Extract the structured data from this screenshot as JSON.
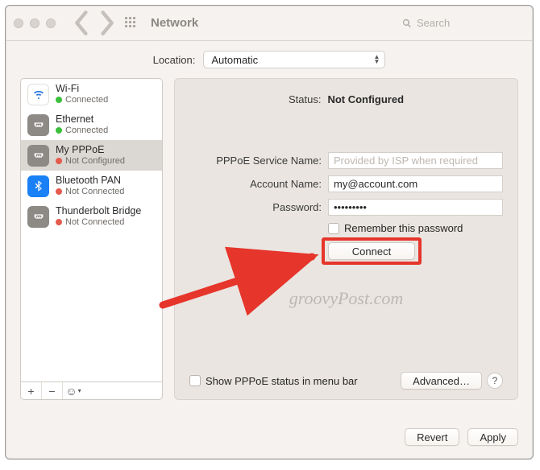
{
  "title": "Network",
  "search_placeholder": "Search",
  "location": {
    "label": "Location:",
    "value": "Automatic"
  },
  "sidebar": {
    "items": [
      {
        "name": "Wi-Fi",
        "status": "Connected",
        "dot": "green"
      },
      {
        "name": "Ethernet",
        "status": "Connected",
        "dot": "green"
      },
      {
        "name": "My PPPoE",
        "status": "Not Configured",
        "dot": "red"
      },
      {
        "name": "Bluetooth PAN",
        "status": "Not Connected",
        "dot": "red"
      },
      {
        "name": "Thunderbolt Bridge",
        "status": "Not Connected",
        "dot": "red"
      }
    ]
  },
  "status": {
    "label": "Status:",
    "value": "Not Configured"
  },
  "form": {
    "service_label": "PPPoE Service Name:",
    "service_placeholder": "Provided by ISP when required",
    "service_value": "",
    "account_label": "Account Name:",
    "account_value": "my@account.com",
    "password_label": "Password:",
    "password_value": "•••••••••",
    "remember_label": "Remember this password",
    "connect_label": "Connect"
  },
  "show_status_label": "Show PPPoE status in menu bar",
  "advanced_label": "Advanced…",
  "help_label": "?",
  "revert_label": "Revert",
  "apply_label": "Apply",
  "watermark": "groovyPost.com"
}
